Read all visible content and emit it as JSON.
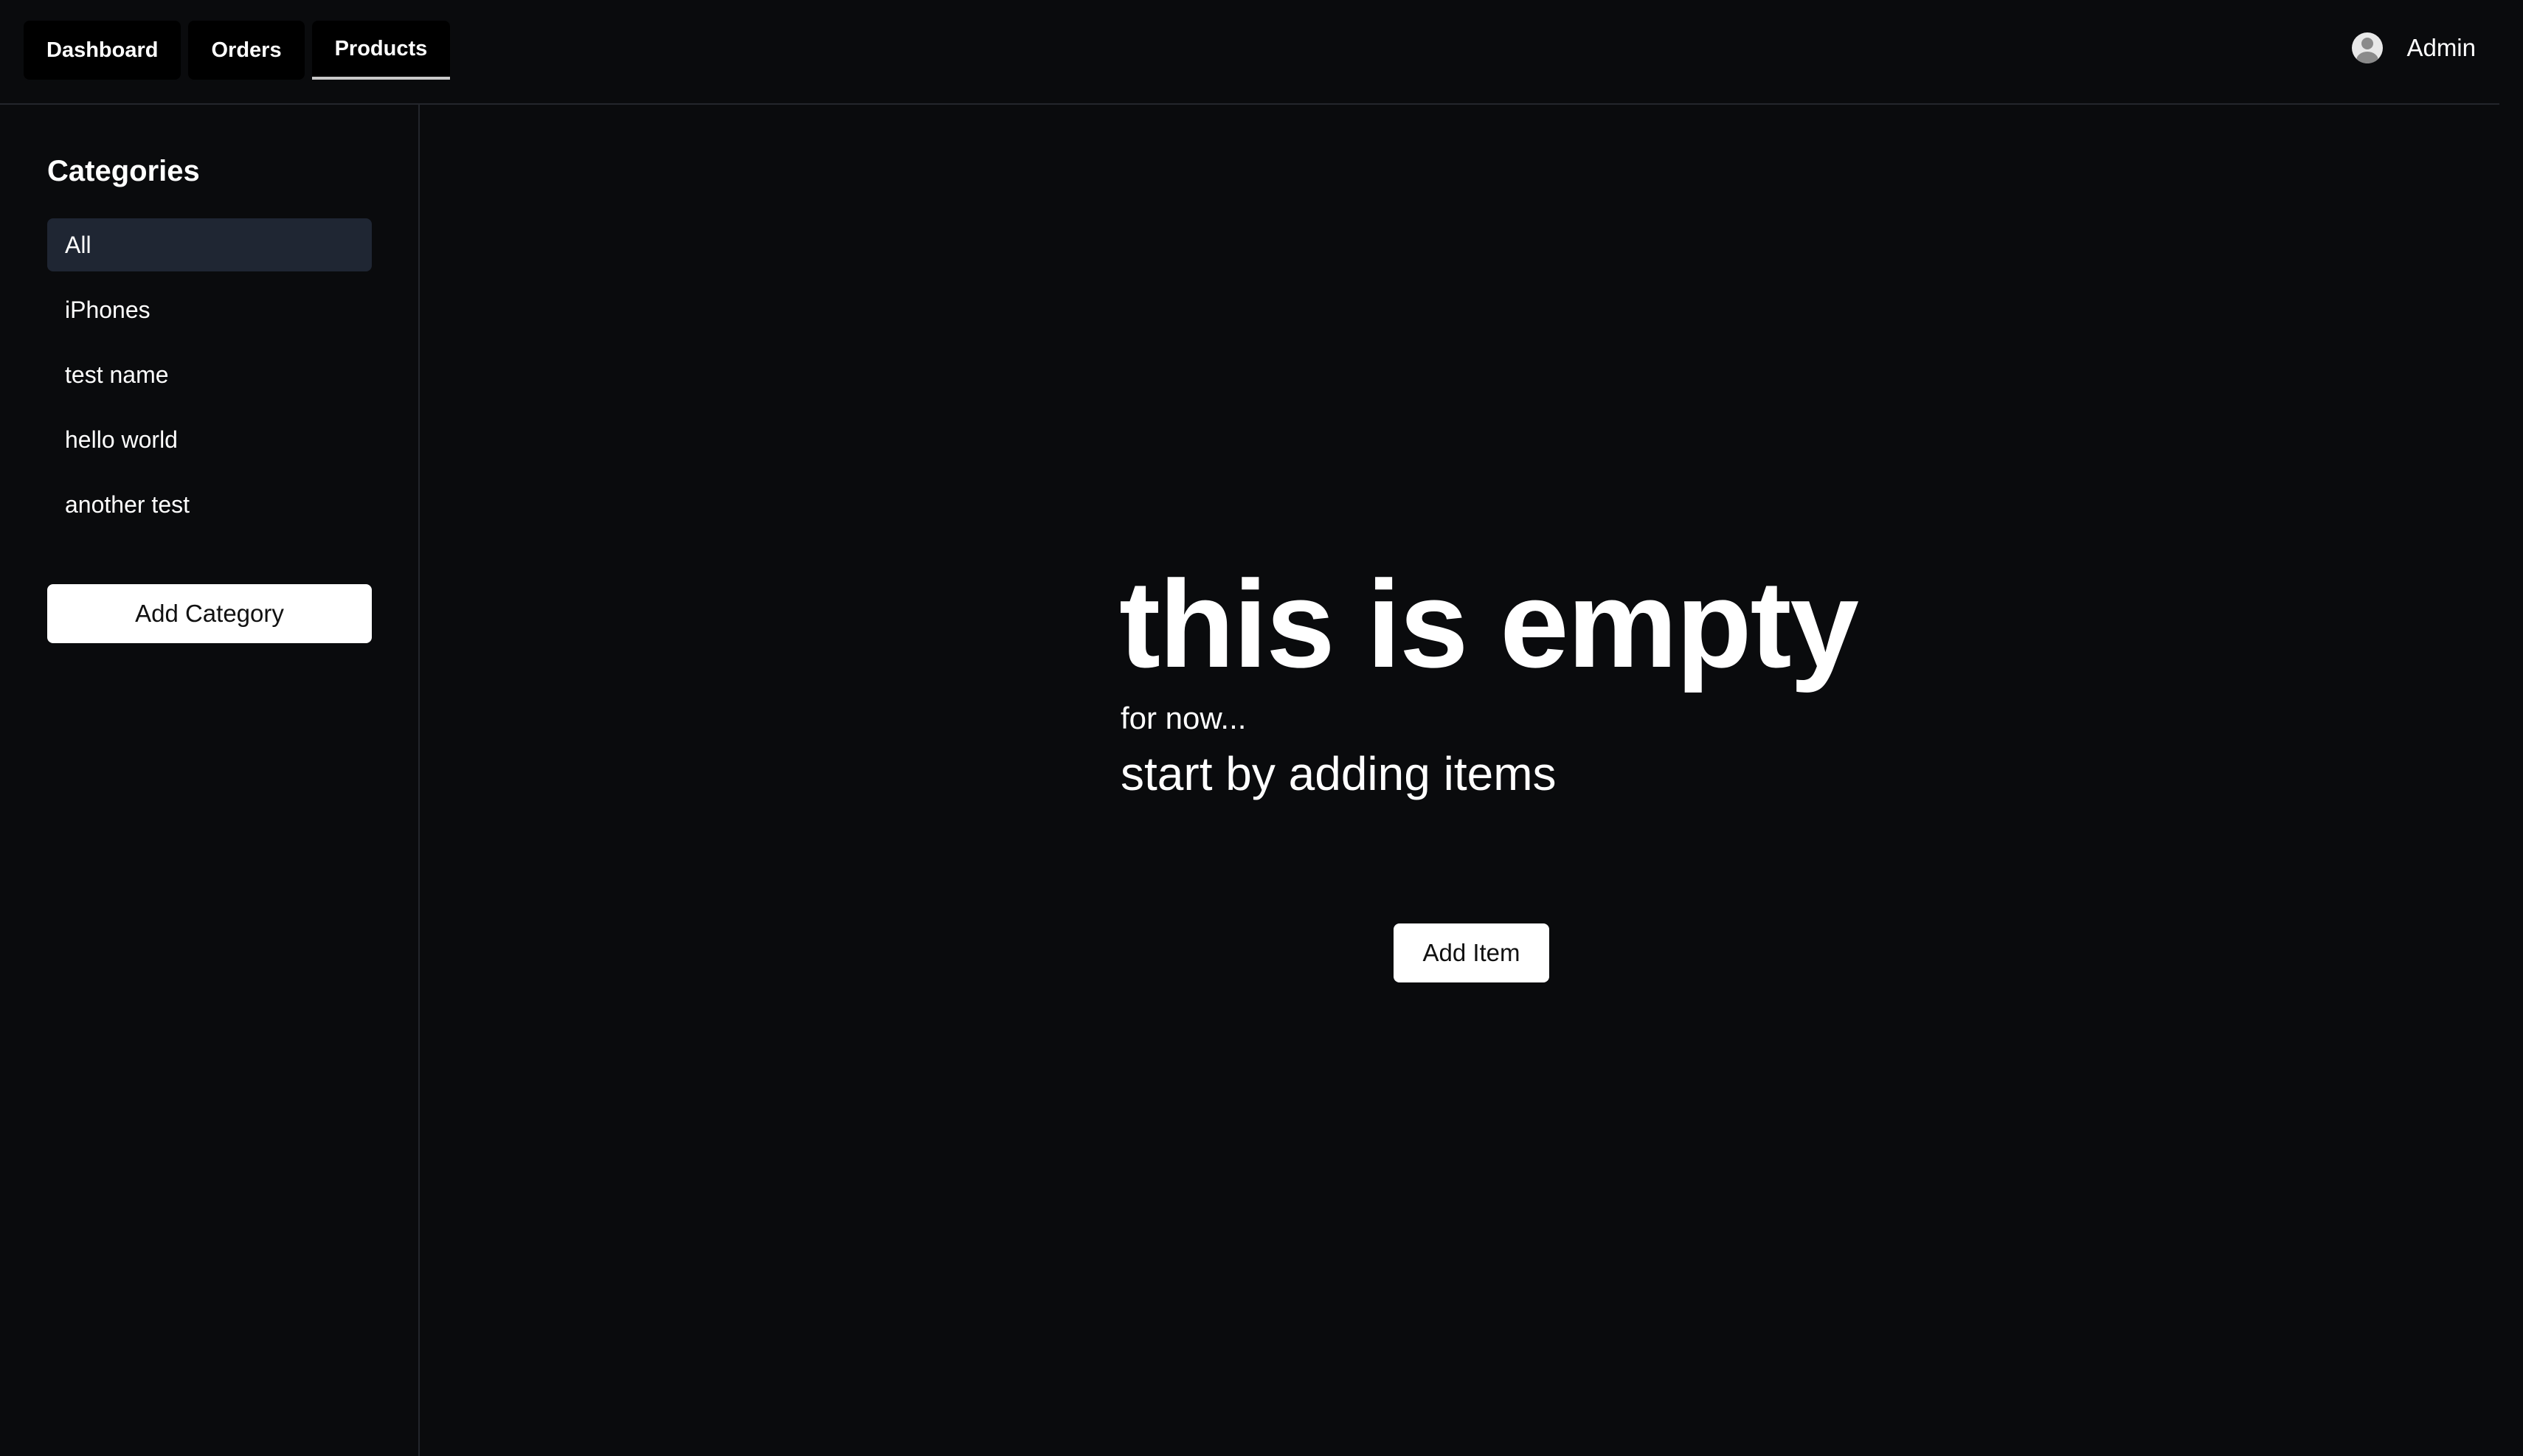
{
  "nav": {
    "tabs": [
      {
        "label": "Dashboard",
        "active": false
      },
      {
        "label": "Orders",
        "active": false
      },
      {
        "label": "Products",
        "active": true
      }
    ],
    "user": {
      "name": "Admin",
      "icon": "user-avatar-icon"
    }
  },
  "sidebar": {
    "title": "Categories",
    "items": [
      {
        "label": "All",
        "active": true
      },
      {
        "label": "iPhones",
        "active": false
      },
      {
        "label": "test name",
        "active": false
      },
      {
        "label": "hello world",
        "active": false
      },
      {
        "label": "another test",
        "active": false
      }
    ],
    "add_button": "Add Category"
  },
  "main": {
    "empty_title": "this is empty",
    "empty_subtitle": "for now...",
    "empty_hint": "start by adding items",
    "add_button": "Add Item"
  },
  "colors": {
    "background": "#0a0b0d",
    "active_category": "#1f2633",
    "button_bg": "#ffffff",
    "border": "#23262c"
  }
}
